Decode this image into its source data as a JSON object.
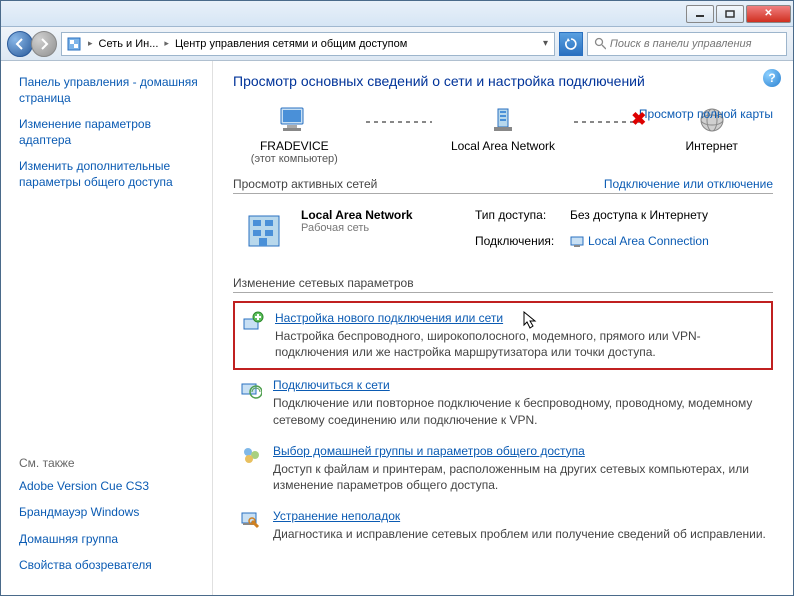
{
  "titlebar": {},
  "nav": {
    "breadcrumb1_short": "Сеть и Ин...",
    "breadcrumb2": "Центр управления сетями и общим доступом",
    "search_placeholder": "Поиск в панели управления"
  },
  "sidebar": {
    "links": [
      "Панель управления - домашняя страница",
      "Изменение параметров адаптера",
      "Изменить дополнительные параметры общего доступа"
    ],
    "see_also": "См. также",
    "bottom": [
      "Adobe Version Cue CS3",
      "Брандмауэр Windows",
      "Домашняя группа",
      "Свойства обозревателя"
    ]
  },
  "main": {
    "heading": "Просмотр основных сведений о сети и настройка подключений",
    "full_map": "Просмотр полной карты",
    "map": {
      "computer": "FRADEVICE",
      "computer_sub": "(этот компьютер)",
      "network": "Local Area Network",
      "internet": "Интернет"
    },
    "active_head": "Просмотр активных сетей",
    "active_link": "Подключение или отключение",
    "net": {
      "name": "Local Area Network",
      "type": "Рабочая сеть",
      "access_label": "Тип доступа:",
      "access_value": "Без доступа к Интернету",
      "conn_label": "Подключения:",
      "conn_value": "Local Area Connection"
    },
    "change_head": "Изменение сетевых параметров",
    "tasks": [
      {
        "title": "Настройка нового подключения или сети",
        "desc": "Настройка беспроводного, широкополосного, модемного, прямого или VPN-подключения или же настройка маршрутизатора или точки доступа."
      },
      {
        "title": "Подключиться к сети",
        "desc": "Подключение или повторное подключение к беспроводному, проводному, модемному сетевому соединению или подключение к VPN."
      },
      {
        "title": "Выбор домашней группы и параметров общего доступа",
        "desc": "Доступ к файлам и принтерам, расположенным на других сетевых компьютерах, или изменение параметров общего доступа."
      },
      {
        "title": "Устранение неполадок",
        "desc": "Диагностика и исправление сетевых проблем или получение сведений об исправлении."
      }
    ]
  }
}
